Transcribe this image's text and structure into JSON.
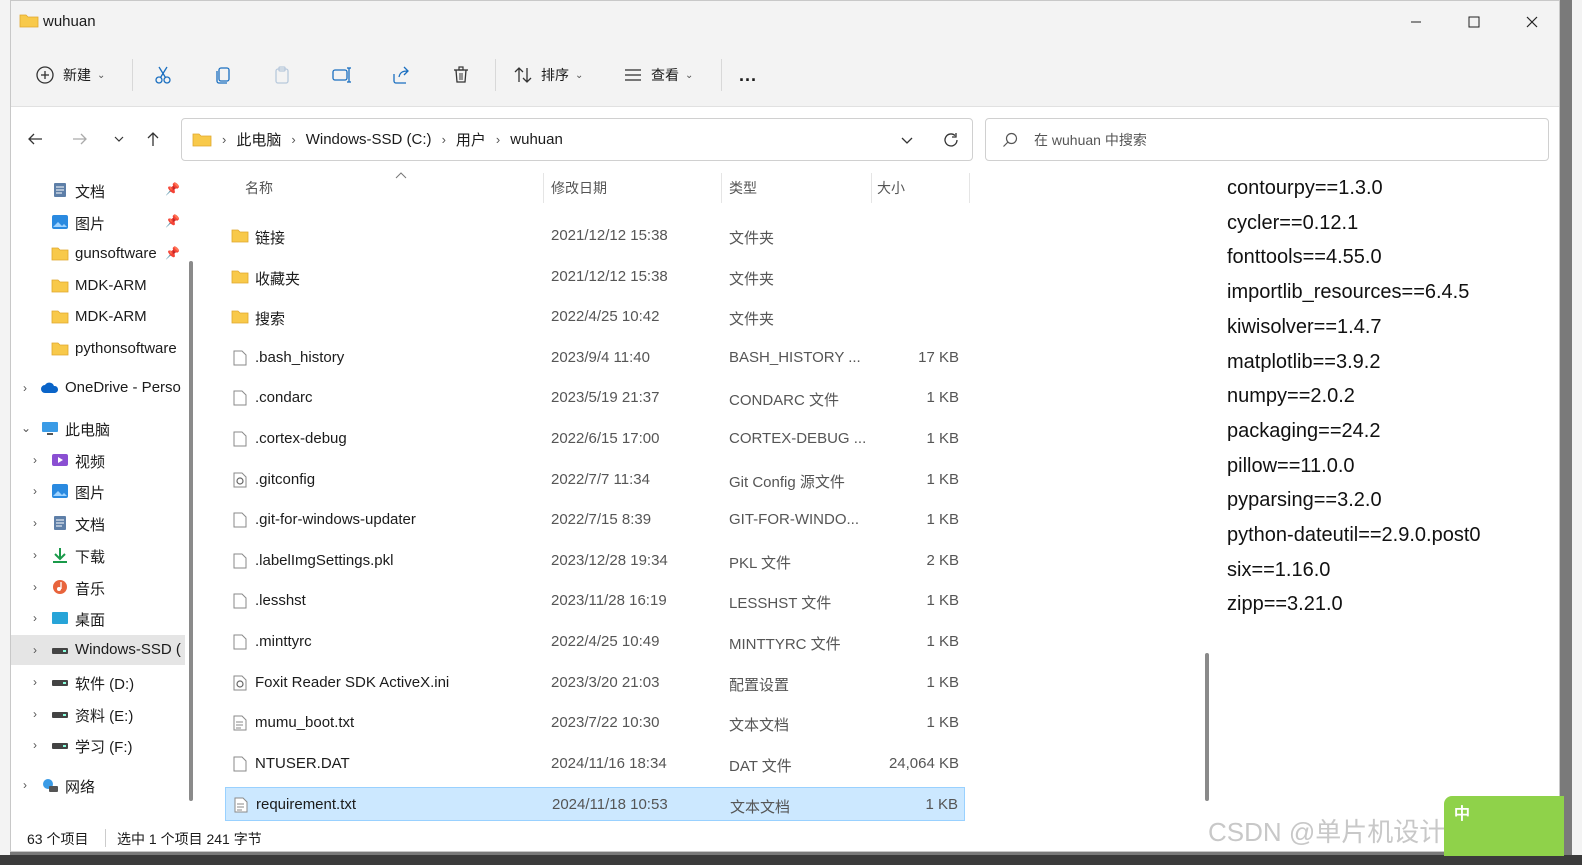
{
  "window": {
    "title": "wuhuan"
  },
  "toolbar": {
    "new_label": "新建",
    "sort_label": "排序",
    "view_label": "查看",
    "more_label": "..."
  },
  "address": {
    "crumbs": [
      "此电脑",
      "Windows-SSD (C:)",
      "用户",
      "wuhuan"
    ]
  },
  "search": {
    "placeholder": "在 wuhuan 中搜索"
  },
  "sidebar": {
    "items": [
      {
        "label": "文档",
        "icon": "document-icon",
        "pinned": true
      },
      {
        "label": "图片",
        "icon": "picture-icon",
        "pinned": true
      },
      {
        "label": "gunsoftware",
        "icon": "folder-icon",
        "pinned": true
      },
      {
        "label": "MDK-ARM",
        "icon": "folder-icon"
      },
      {
        "label": "MDK-ARM",
        "icon": "folder-icon"
      },
      {
        "label": "pythonsoftware",
        "icon": "folder-icon"
      },
      {
        "label": "OneDrive - Perso",
        "icon": "cloud-icon"
      },
      {
        "label": "此电脑",
        "icon": "computer-icon"
      },
      {
        "label": "视频",
        "icon": "video-icon"
      },
      {
        "label": "图片",
        "icon": "picture-icon"
      },
      {
        "label": "文档",
        "icon": "document-icon"
      },
      {
        "label": "下载",
        "icon": "download-icon"
      },
      {
        "label": "音乐",
        "icon": "music-icon"
      },
      {
        "label": "桌面",
        "icon": "desktop-icon"
      },
      {
        "label": "Windows-SSD (",
        "icon": "drive-icon"
      },
      {
        "label": "软件 (D:)",
        "icon": "drive-icon"
      },
      {
        "label": "资料 (E:)",
        "icon": "drive-icon"
      },
      {
        "label": "学习 (F:)",
        "icon": "drive-icon"
      },
      {
        "label": "网络",
        "icon": "network-icon"
      }
    ]
  },
  "columns": {
    "name": "名称",
    "date": "修改日期",
    "type": "类型",
    "size": "大小"
  },
  "files": [
    {
      "name": "链接",
      "date": "2021/12/12 15:38",
      "type": "文件夹",
      "size": "",
      "icon": "folder-icon"
    },
    {
      "name": "收藏夹",
      "date": "2021/12/12 15:38",
      "type": "文件夹",
      "size": "",
      "icon": "folder-icon"
    },
    {
      "name": "搜索",
      "date": "2022/4/25 10:42",
      "type": "文件夹",
      "size": "",
      "icon": "folder-icon"
    },
    {
      "name": ".bash_history",
      "date": "2023/9/4 11:40",
      "type": "BASH_HISTORY ...",
      "size": "17 KB",
      "icon": "file-icon"
    },
    {
      "name": ".condarc",
      "date": "2023/5/19 21:37",
      "type": "CONDARC 文件",
      "size": "1 KB",
      "icon": "file-icon"
    },
    {
      "name": ".cortex-debug",
      "date": "2022/6/15 17:00",
      "type": "CORTEX-DEBUG ...",
      "size": "1 KB",
      "icon": "file-icon"
    },
    {
      "name": ".gitconfig",
      "date": "2022/7/7 11:34",
      "type": "Git Config 源文件",
      "size": "1 KB",
      "icon": "config-file-icon"
    },
    {
      "name": ".git-for-windows-updater",
      "date": "2022/7/15 8:39",
      "type": "GIT-FOR-WINDO...",
      "size": "1 KB",
      "icon": "file-icon"
    },
    {
      "name": ".labelImgSettings.pkl",
      "date": "2023/12/28 19:34",
      "type": "PKL 文件",
      "size": "2 KB",
      "icon": "file-icon"
    },
    {
      "name": ".lesshst",
      "date": "2023/11/28 16:19",
      "type": "LESSHST 文件",
      "size": "1 KB",
      "icon": "file-icon"
    },
    {
      "name": ".minttyrc",
      "date": "2022/4/25 10:49",
      "type": "MINTTYRC 文件",
      "size": "1 KB",
      "icon": "file-icon"
    },
    {
      "name": "Foxit Reader SDK ActiveX.ini",
      "date": "2023/3/20 21:03",
      "type": "配置设置",
      "size": "1 KB",
      "icon": "config-file-icon"
    },
    {
      "name": "mumu_boot.txt",
      "date": "2023/7/22 10:30",
      "type": "文本文档",
      "size": "1 KB",
      "icon": "text-file-icon"
    },
    {
      "name": "NTUSER.DAT",
      "date": "2024/11/16 18:34",
      "type": "DAT 文件",
      "size": "24,064 KB",
      "icon": "file-icon"
    },
    {
      "name": "requirement.txt",
      "date": "2024/11/18 10:53",
      "type": "文本文档",
      "size": "1 KB",
      "icon": "text-file-icon",
      "selected": true
    }
  ],
  "preview": {
    "lines": [
      "contourpy==1.3.0",
      "cycler==0.12.1",
      "fonttools==4.55.0",
      "importlib_resources==6.4.5",
      "kiwisolver==1.4.7",
      "matplotlib==3.9.2",
      "numpy==2.0.2",
      "packaging==24.2",
      "pillow==11.0.0",
      "pyparsing==3.2.0",
      "python-dateutil==2.9.0.post0",
      "six==1.16.0",
      "zipp==3.21.0"
    ]
  },
  "status": {
    "count": "63 个项目",
    "selected": "选中 1 个项目  241 字节"
  },
  "watermark": "CSDN @单片机设计与开发",
  "ime": {
    "label": "中"
  },
  "colors": {
    "folder": "#f8c94a",
    "selection": "#cce8ff",
    "selection_border": "#99d1ff",
    "accent": "#0067c0"
  }
}
